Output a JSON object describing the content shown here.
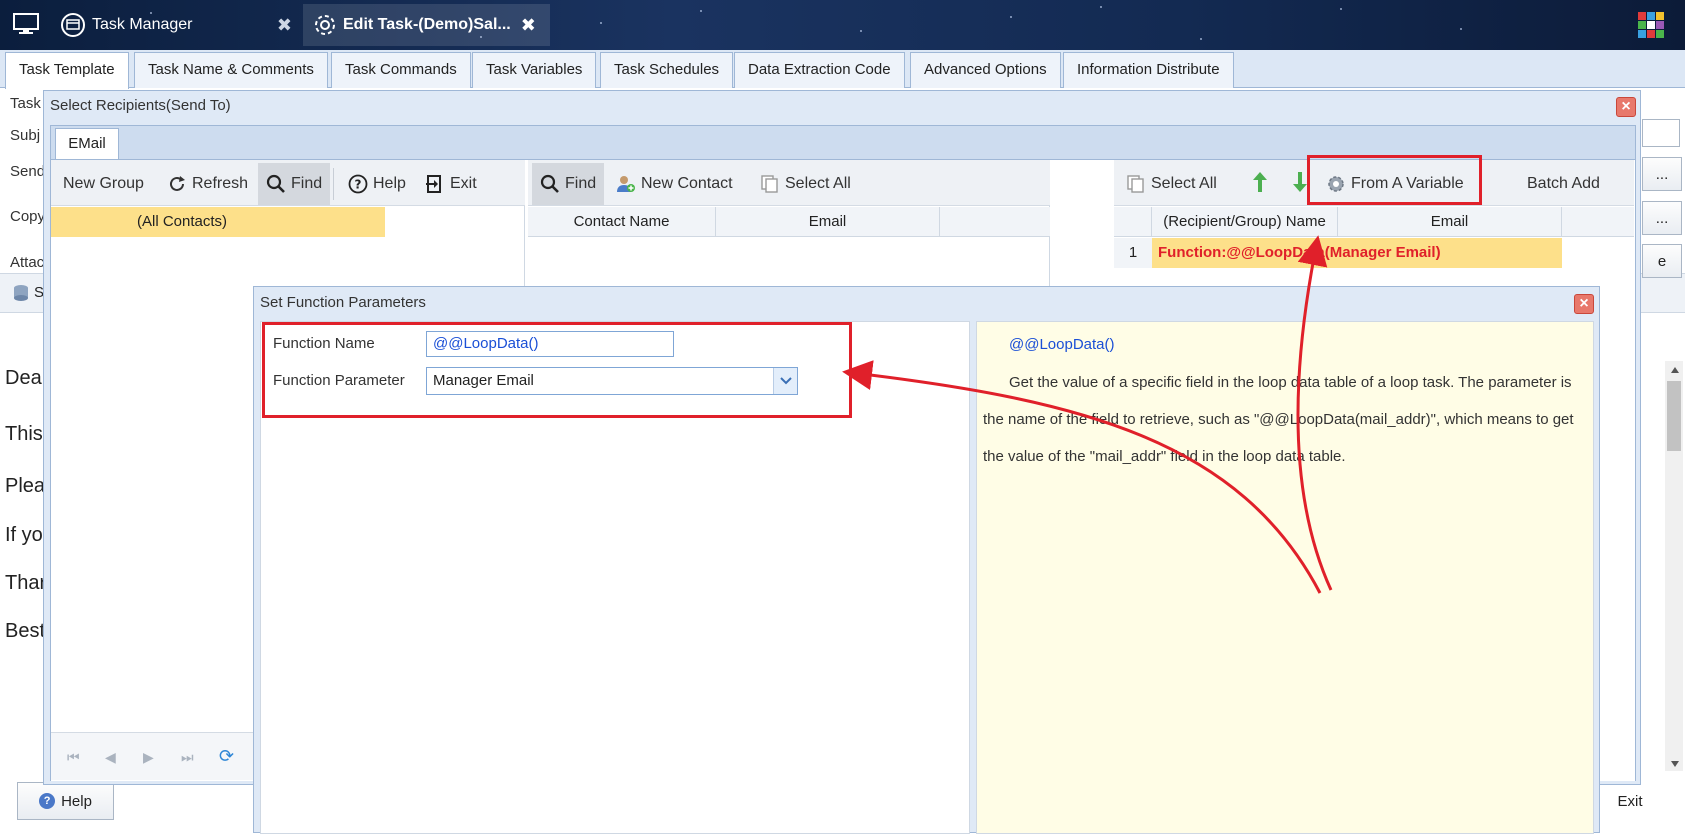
{
  "window_tabs": [
    {
      "label": "Task Manager",
      "icon": "globe-window-icon"
    },
    {
      "label": "Edit Task-(Demo)Sal...",
      "icon": "gear-icon"
    }
  ],
  "main_tabs": [
    "Task Template",
    "Task Name & Comments",
    "Task Commands",
    "Task Variables",
    "Task Schedules",
    "Data Extraction Code",
    "Advanced Options",
    "Information Distribute"
  ],
  "background": {
    "labels": [
      "Task",
      "Subj",
      "Send",
      "Copy",
      "Attac"
    ],
    "toolbar_fragment": "S",
    "body_lines": [
      "Dea",
      "This",
      "Plea",
      "If yo",
      "Thar",
      "Best"
    ],
    "help_label": "Help",
    "exit_label": "Exit",
    "ellipsis": "...",
    "e_fragment": "e"
  },
  "recipients_dialog": {
    "title": "Select Recipients(Send To)",
    "tab": "EMail",
    "left_toolbar": [
      "New Group",
      "Refresh",
      "Find",
      "Help",
      "Exit"
    ],
    "group_row": "(All Contacts)",
    "mid_toolbar": [
      "Find",
      "New Contact",
      "Select All"
    ],
    "contact_columns": [
      "Contact Name",
      "Email"
    ],
    "right_toolbar": {
      "select_all": "Select All",
      "from_variable": "From A Variable",
      "batch_add": "Batch Add"
    },
    "recipient_columns": [
      "(Recipient/Group) Name",
      "Email"
    ],
    "recipient_rows": [
      {
        "index": "1",
        "name": "Function:@@LoopData(Manager Email)"
      }
    ]
  },
  "function_dialog": {
    "title": "Set Function Parameters",
    "name_label": "Function Name",
    "name_value": "@@LoopData()",
    "param_label": "Function Parameter",
    "param_value": "Manager Email",
    "help_title": "@@LoopData()",
    "help_text": "Get the value of a specific field in the loop data table of a loop task. The parameter is the name of the field to retrieve, such as \"@@LoopData(mail_addr)\", which means to get the value of the \"mail_addr\" field in the loop data table."
  },
  "colors": {
    "accent_red": "#e0202a",
    "highlight_row": "#fde08a",
    "help_bg": "#fffde6",
    "link_blue": "#1a4fd6"
  }
}
